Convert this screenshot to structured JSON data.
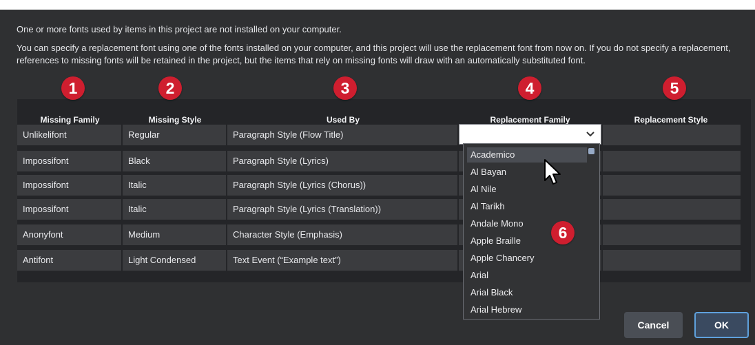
{
  "messages": {
    "line1": "One or more fonts used by items in this project are not installed on your computer.",
    "line2": "You can specify a replacement font using one of the fonts installed on your computer, and this project will use the replacement font from now on. If you do not specify a replacement, references to missing fonts will be retained in the project, but the items that rely on missing fonts will draw with an automatically substituted font."
  },
  "badges": [
    "1",
    "2",
    "3",
    "4",
    "5",
    "6"
  ],
  "table": {
    "columns": [
      "Missing Family",
      "Missing Style",
      "Used By",
      "Replacement Family",
      "Replacement Style"
    ],
    "rows": [
      [
        "Unlikelifont",
        "Regular",
        "Paragraph Style (Flow Title)"
      ],
      [
        "Impossifont",
        "Black",
        "Paragraph Style (Lyrics)"
      ],
      [
        "Impossifont",
        "Italic",
        "Paragraph Style (Lyrics (Chorus))"
      ],
      [
        "Impossifont",
        "Italic",
        "Paragraph Style (Lyrics (Translation))"
      ],
      [
        "Anonyfont",
        "Medium",
        "Character Style (Emphasis)"
      ],
      [
        "Antifont",
        "Light Condensed",
        "Text Event (“Example text”)"
      ]
    ]
  },
  "replacement_select": {
    "value": "",
    "icon": "chevron-down-icon"
  },
  "dropdown": {
    "options": [
      "Academico",
      "Al Bayan",
      "Al Nile",
      "Al Tarikh",
      "Andale Mono",
      "Apple Braille",
      "Apple Chancery",
      "Arial",
      "Arial Black",
      "Arial Hebrew"
    ],
    "highlighted": "Academico"
  },
  "buttons": {
    "cancel": "Cancel",
    "ok": "OK"
  },
  "colors": {
    "badge": "#cf1e2f",
    "ok_border": "#5fa1dd",
    "dialog_bg": "#2f3032"
  }
}
